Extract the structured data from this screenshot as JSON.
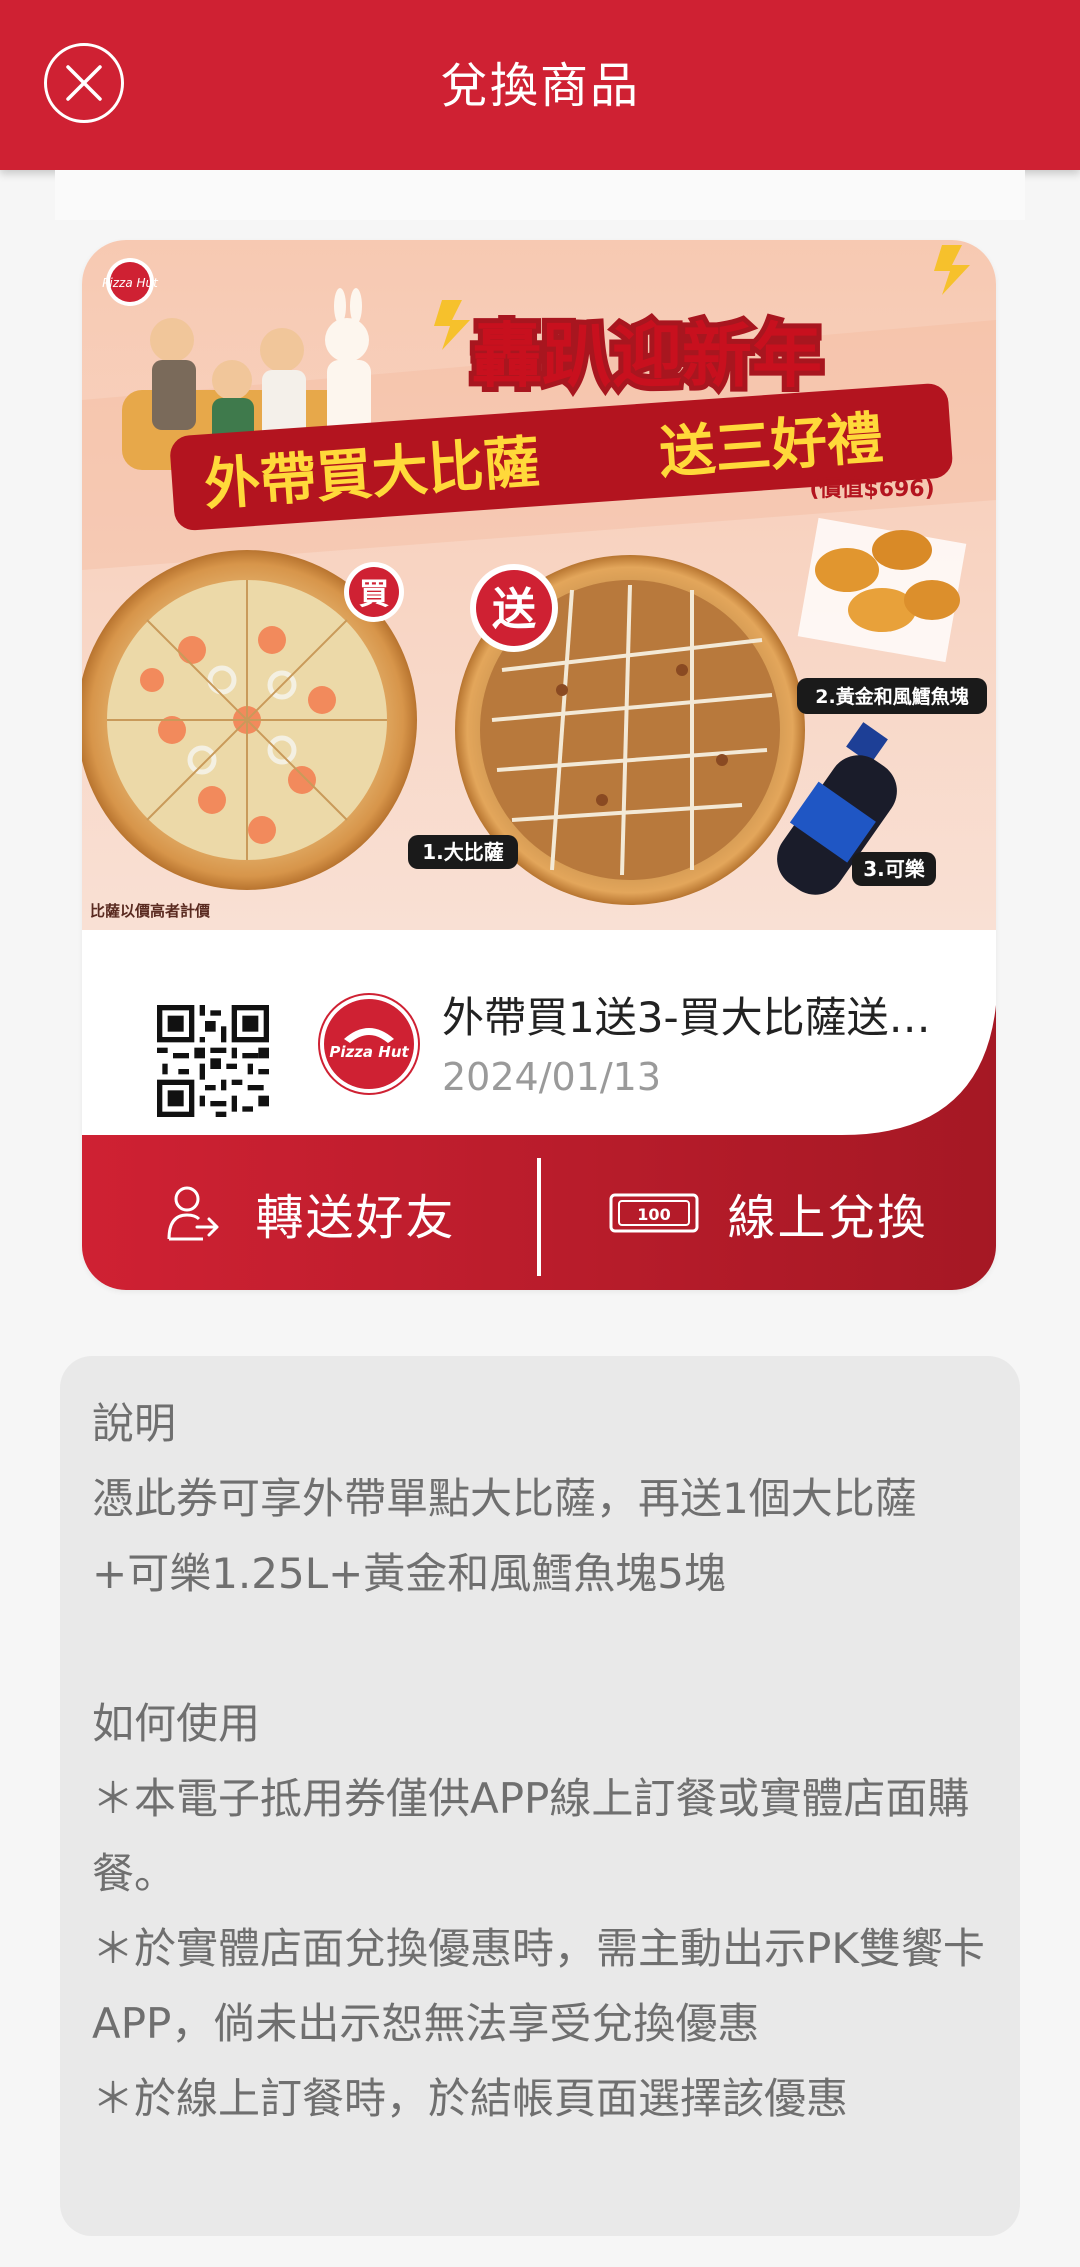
{
  "header": {
    "title": "兌換商品",
    "close_icon": "close-icon",
    "color": "#cf2133"
  },
  "banner": {
    "headline": "轟趴迎新年",
    "subhead_left": "外帶買大比薩",
    "subhead_right": "送三好禮",
    "value_note": "(價值$696)",
    "buy_badge": "買",
    "gift_badge": "送",
    "item1": "1.大比薩",
    "item2": "2.黃金和風鱈魚塊",
    "item3": "3.可樂",
    "footnote": "比薩以價高者計價",
    "brand": "Pizza Hut"
  },
  "coupon": {
    "title": "外帶買1送3-買大比薩送…",
    "date": "2024/01/13",
    "brand_logo": "Pizza Hut"
  },
  "actions": {
    "transfer_label": "轉送好友",
    "transfer_icon": "person-share-icon",
    "redeem_label": "線上兌換",
    "redeem_icon": "ticket-100-icon",
    "ticket_text": "100"
  },
  "description": {
    "section1_title": "說明",
    "section1_body": "憑此券可享外帶單點大比薩，再送1個大比薩+可樂1.25L+黃金和風鱈魚塊5塊",
    "section2_title": "如何使用",
    "rule1": "＊本電子抵用券僅供APP線上訂餐或實體店面購餐。",
    "rule2": "＊於實體店面兌換優惠時，需主動出示PK雙饗卡APP，倘未出示恕無法享受兌換優惠",
    "rule3": "＊於線上訂餐時，於結帳頁面選擇該優惠"
  }
}
